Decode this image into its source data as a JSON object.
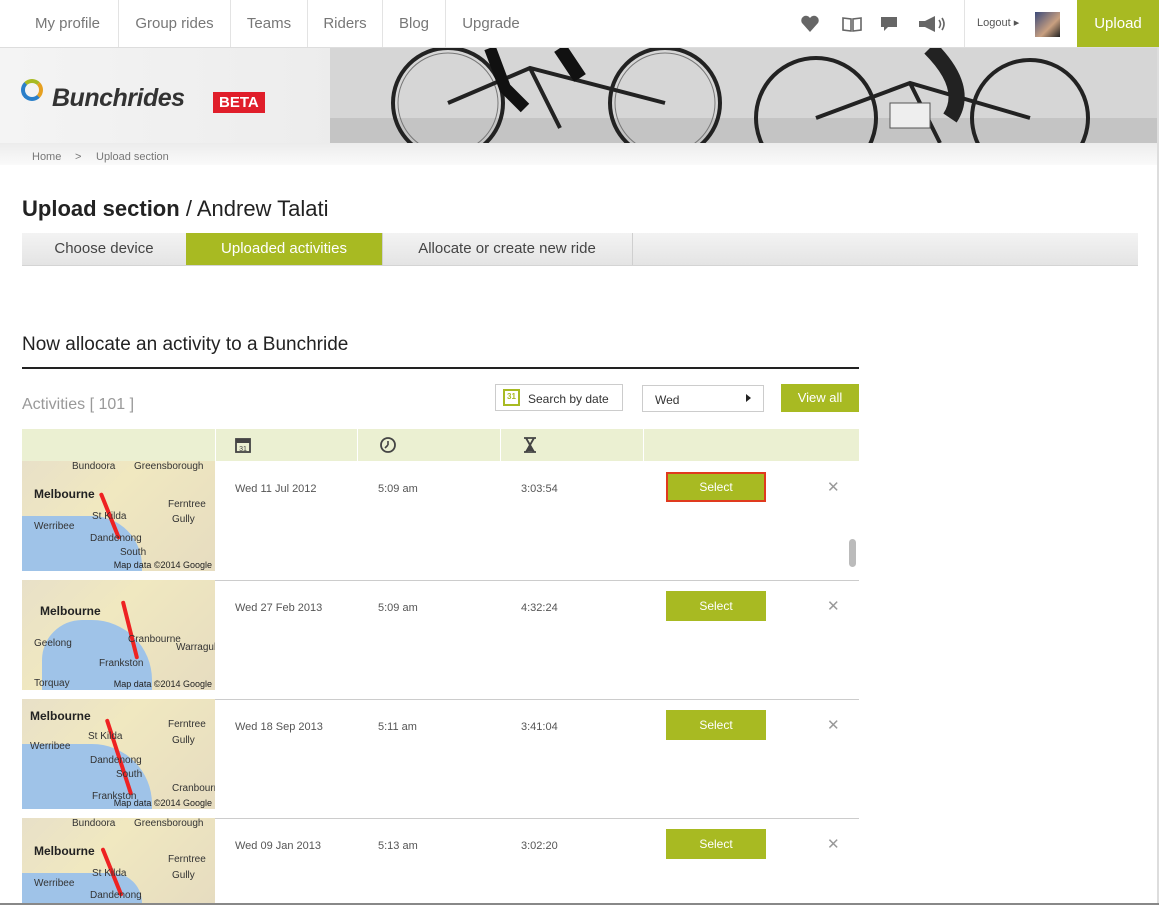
{
  "nav": {
    "items": [
      "My profile",
      "Group rides",
      "Teams",
      "Riders",
      "Blog",
      "Upgrade"
    ],
    "logout": "Logout",
    "upload": "Upload",
    "icons": [
      "heart-icon",
      "book-icon",
      "chat-icon",
      "megaphone-icon"
    ]
  },
  "brand": {
    "name": "Bunchrides",
    "badge": "BETA"
  },
  "breadcrumb": {
    "home": "Home",
    "sep": ">",
    "current": "Upload section"
  },
  "page": {
    "title_bold": "Upload section",
    "title_sep": "/",
    "title_user": "Andrew Talati"
  },
  "tabs": [
    "Choose device",
    "Uploaded activities",
    "Allocate or create new ride"
  ],
  "section": {
    "title": "Now allocate an activity to a Bunchride",
    "activities_label": "Activities [ 101 ]",
    "search_date": "Search by date",
    "day_filter": "Wed",
    "view_all": "View all"
  },
  "colors": {
    "accent": "#a8ba22",
    "beta": "#e01e2a",
    "focus": "#e03a1e"
  },
  "activities": [
    {
      "date": "Wed 11 Jul 2012",
      "time": "5:09 am",
      "duration": "3:03:54",
      "select": "Select",
      "map": {
        "city": "Melbourne",
        "towns": [
          "Bundoora",
          "Greensborough",
          "Ferntree",
          "Gully",
          "Werribee",
          "St Kilda",
          "Dandenong",
          "South"
        ],
        "credit": "Map data ©2014 Google"
      }
    },
    {
      "date": "Wed 27 Feb 2013",
      "time": "5:09 am",
      "duration": "4:32:24",
      "select": "Select",
      "map": {
        "city": "Melbourne",
        "towns": [
          "Geelong",
          "Cranbourne",
          "Frankston",
          "Warragul",
          "Torquay"
        ],
        "credit": "Map data ©2014 Google"
      }
    },
    {
      "date": "Wed 18 Sep 2013",
      "time": "5:11 am",
      "duration": "3:41:04",
      "select": "Select",
      "map": {
        "city": "Melbourne",
        "towns": [
          "Ferntree",
          "Gully",
          "Werribee",
          "St Kilda",
          "Dandenong",
          "South",
          "Cranbourne",
          "Frankston"
        ],
        "credit": "Map data ©2014 Google"
      }
    },
    {
      "date": "Wed 09 Jan 2013",
      "time": "5:13 am",
      "duration": "3:02:20",
      "select": "Select",
      "map": {
        "city": "Melbourne",
        "towns": [
          "Bundoora",
          "Greensborough",
          "Ferntree",
          "Gully",
          "Werribee",
          "St Kilda",
          "Dandenong"
        ],
        "credit": ""
      }
    }
  ]
}
